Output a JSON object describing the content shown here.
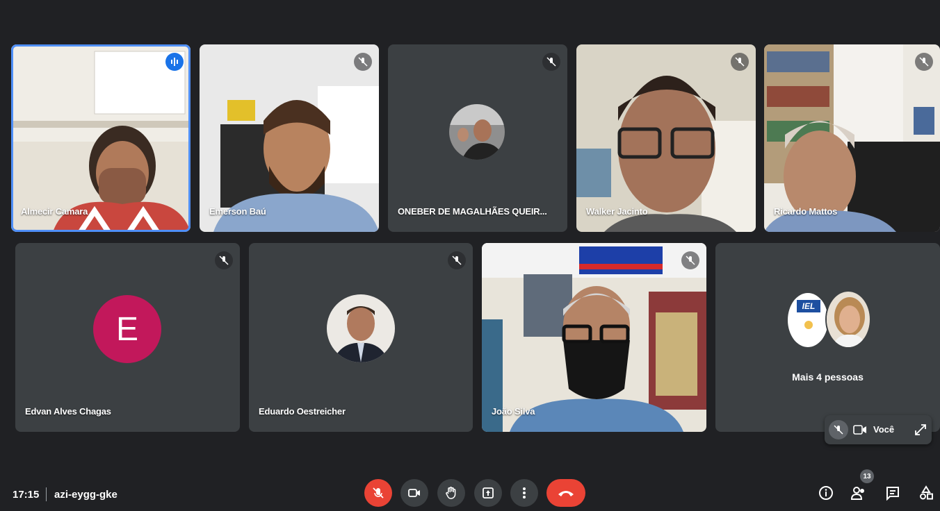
{
  "meeting": {
    "time": "17:15",
    "code": "azi-eygg-gke"
  },
  "participants_row1": [
    {
      "name": "Almecir Camara",
      "state": "speaking"
    },
    {
      "name": "Emerson Baú",
      "state": "muted"
    },
    {
      "name": "ONEBER DE MAGALHÃES QUEIR...",
      "state": "muted"
    },
    {
      "name": "Walker Jacinto",
      "state": "muted"
    },
    {
      "name": "Ricardo Mattos",
      "state": "muted"
    }
  ],
  "participants_row2": [
    {
      "name": "Edvan Alves Chagas",
      "initial": "E",
      "avatar_color": "#c2185b"
    },
    {
      "name": "Eduardo Oestreicher"
    },
    {
      "name": "João Silva"
    }
  ],
  "more_tile": {
    "label": "Mais 4 pessoas",
    "logo_text": "IEL"
  },
  "self_view": {
    "label": "Você"
  },
  "participants_count": "13",
  "colors": {
    "background": "#202124",
    "tile": "#3c4043",
    "accent": "#1a73e8",
    "danger": "#ea4335"
  },
  "icons": [
    "mic-off-icon",
    "camera-icon",
    "raise-hand-icon",
    "present-icon",
    "more-icon",
    "hangup-icon",
    "info-icon",
    "people-icon",
    "chat-icon",
    "activities-icon",
    "expand-icon"
  ]
}
